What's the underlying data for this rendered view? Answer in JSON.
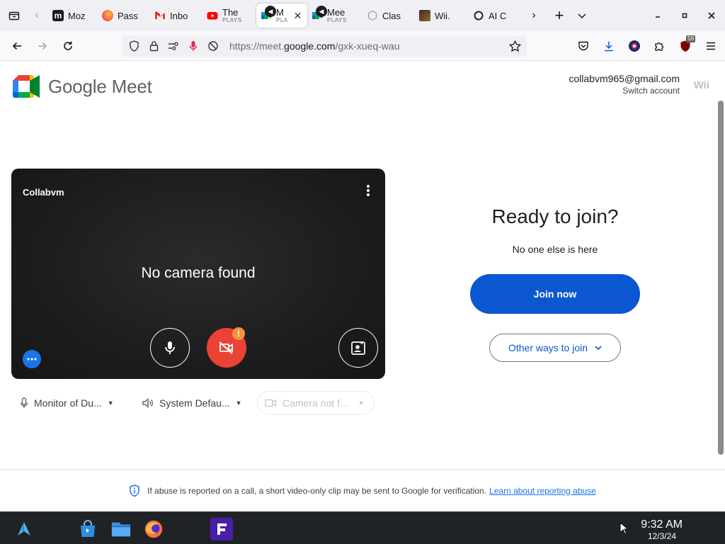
{
  "browser": {
    "tabs": [
      {
        "title": "Moz",
        "sub": "",
        "icon": "mozilla-m-icon",
        "color": "#1b1b1b"
      },
      {
        "title": "Pass",
        "sub": "",
        "icon": "firefox-icon",
        "color": "#ff7139"
      },
      {
        "title": "Inbo",
        "sub": "",
        "icon": "gmail-icon",
        "color": "#ea4335"
      },
      {
        "title": "The",
        "sub": "PLAYS",
        "icon": "youtube-icon",
        "color": "#ff0000"
      },
      {
        "title": "M",
        "sub": "PLA",
        "icon": "meet-icon",
        "color": "#00832d",
        "selected": true,
        "audio": true
      },
      {
        "title": "Mee",
        "sub": "PLAYS",
        "icon": "meet-icon",
        "color": "#00832d",
        "audio": true
      },
      {
        "title": "Clas",
        "sub": "",
        "icon": "classroom-icon",
        "color": "#b0b0b0"
      },
      {
        "title": "Wii.",
        "sub": "",
        "icon": "wii-image-icon",
        "color": "#6b4a2a"
      },
      {
        "title": "AI C",
        "sub": "",
        "icon": "openai-icon",
        "color": "#202124"
      }
    ],
    "url": {
      "prefix": "https://meet.",
      "host": "google.com",
      "path": "/gxk-xueq-wau"
    },
    "badge_count": "59"
  },
  "meet": {
    "brand_google": "Google",
    "brand_meet": "Meet",
    "account_email": "collabvm965@gmail.com",
    "switch_account": "Switch account",
    "account_badge": "Wii",
    "preview_name": "Collabvm",
    "no_camera": "No camera found",
    "warning_badge": "!",
    "ready_title": "Ready to join?",
    "no_one_here": "No one else is here",
    "join_now": "Join now",
    "other_ways": "Other ways to join",
    "devices": {
      "mic": "Monitor of Du...",
      "speaker": "System Defau...",
      "camera": "Camera not f..."
    },
    "abuse_notice": "If abuse is reported on a call, a short video-only clip may be sent to Google for verification.",
    "abuse_link": "Learn about reporting abuse"
  },
  "taskbar": {
    "time": "9:32 AM",
    "date": "12/3/24"
  },
  "colors": {
    "join_blue": "#0b57d0",
    "camera_off_red": "#ea4335",
    "warning_orange": "#fa903e",
    "effects_blue": "#1a73e8"
  }
}
